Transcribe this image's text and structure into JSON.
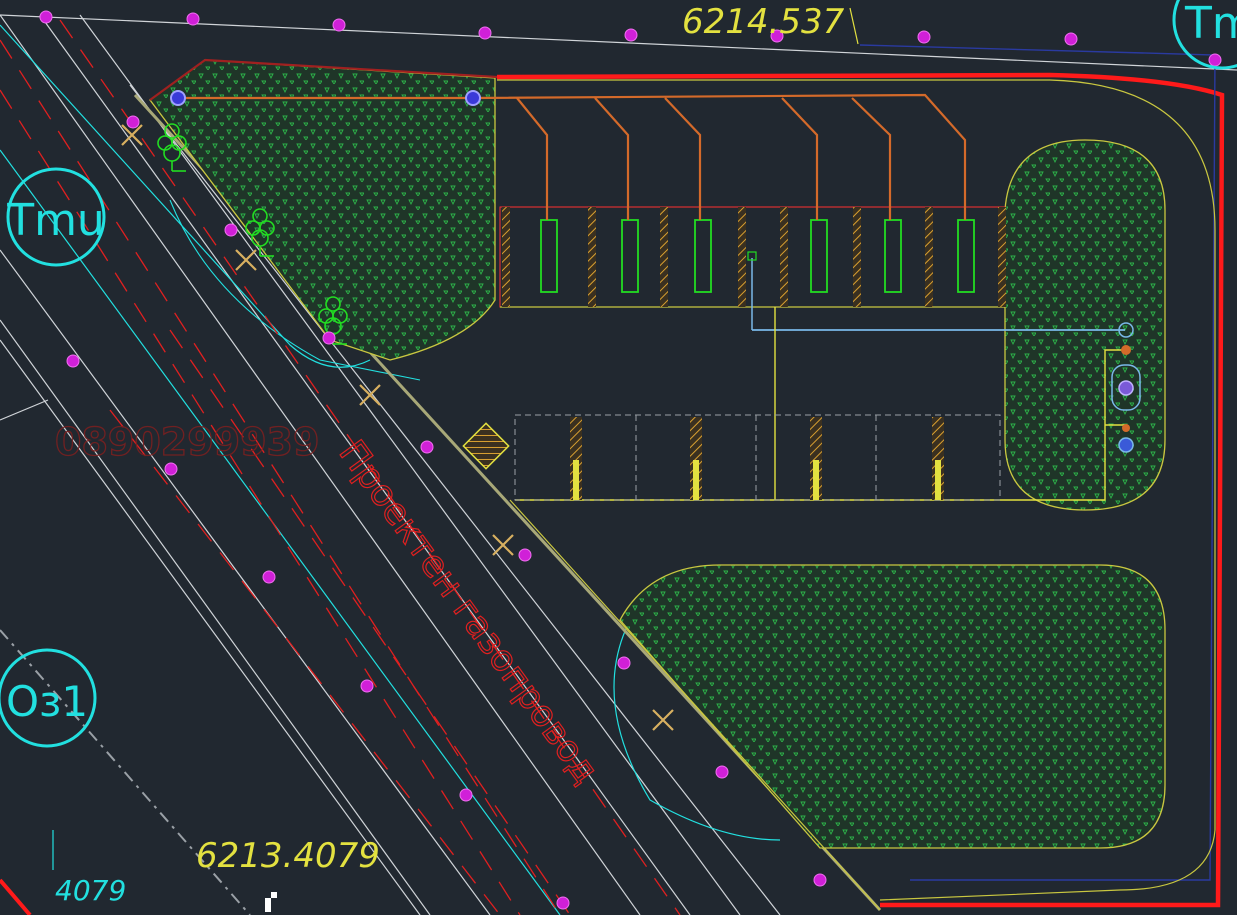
{
  "colors": {
    "background": "#212830",
    "boundary": "#ff1a1a",
    "lawn": "#1f3a2a",
    "lawn_edge": "#c9c740",
    "utility": "#d46a2a",
    "yellow_text": "#e3e140",
    "cyan": "#22e0e0",
    "magenta": "#d020d8",
    "red_text": "#e02020",
    "white_lines": "#d0d4d8",
    "tree": "#22dd22"
  },
  "labels": {
    "coord_top": "6214.537",
    "coord_bottom": "6213.4079",
    "coord_bottom_left": "4079",
    "watermark": "0890299939",
    "pipeline_text": "Проектен газопровод"
  },
  "zone_markers": [
    {
      "name": "zone-tmu-left",
      "text": "Tmu"
    },
    {
      "name": "zone-tmu-top-right",
      "text": "Tm"
    },
    {
      "name": "zone-oz1",
      "text": "Oз1"
    }
  ]
}
